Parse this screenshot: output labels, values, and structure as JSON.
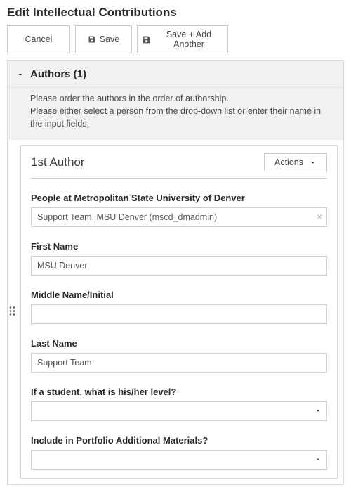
{
  "page": {
    "title": "Edit Intellectual Contributions"
  },
  "toolbar": {
    "cancel_label": "Cancel",
    "save_label": "Save",
    "save_add_label": "Save + Add Another"
  },
  "authors_section": {
    "header": "Authors (1)",
    "instruction_line1": "Please order the authors in the order of authorship.",
    "instruction_line2": "Please either select a person from the drop-down list or enter their name in the input fields."
  },
  "author": {
    "card_title": "1st Author",
    "actions_label": "Actions",
    "people_label": "People at Metropolitan State University of Denver",
    "people_value": "Support Team, MSU Denver (mscd_dmadmin)",
    "first_name_label": "First Name",
    "first_name_value": "MSU Denver",
    "middle_name_label": "Middle Name/Initial",
    "middle_name_value": "",
    "last_name_label": "Last Name",
    "last_name_value": "Support Team",
    "student_level_label": "If a student, what is his/her level?",
    "student_level_value": "",
    "portfolio_label": "Include in Portfolio Additional Materials?",
    "portfolio_value": ""
  }
}
